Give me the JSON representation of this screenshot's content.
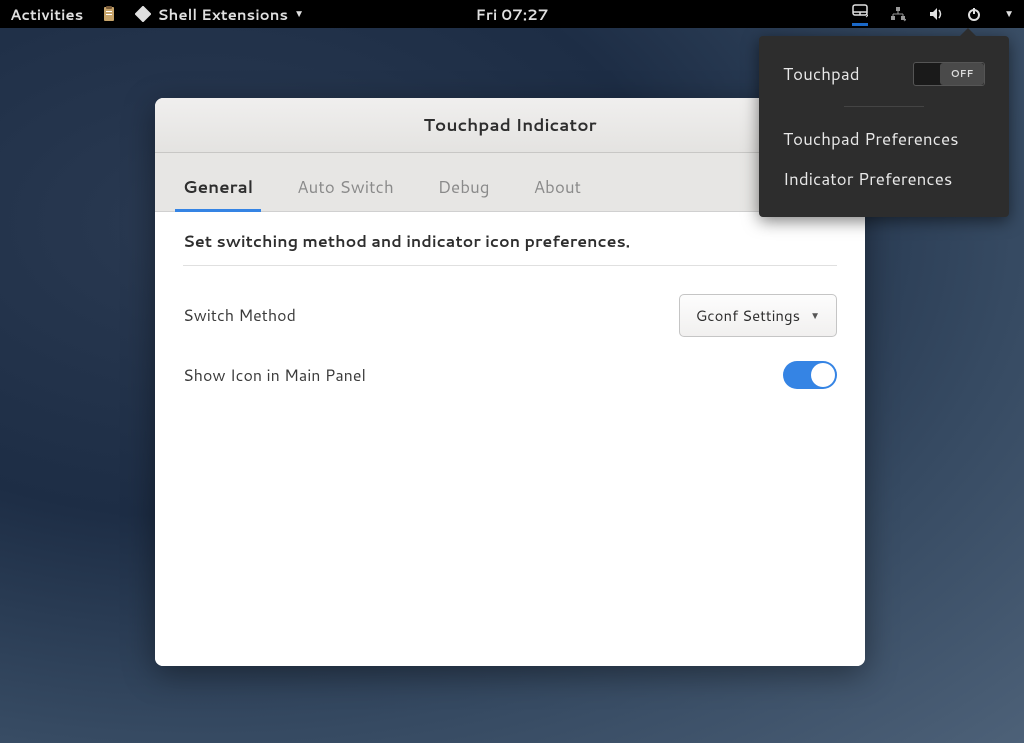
{
  "panel": {
    "activities": "Activities",
    "app_name": "Shell Extensions",
    "clock": "Fri 07:27"
  },
  "popup": {
    "touchpad_label": "Touchpad",
    "toggle_state": "OFF",
    "preferences": "Touchpad Preferences",
    "indicator_preferences": "Indicator Preferences"
  },
  "window": {
    "title": "Touchpad Indicator",
    "tabs": {
      "general": "General",
      "auto_switch": "Auto Switch",
      "debug": "Debug",
      "about": "About"
    },
    "content": {
      "header": "Set switching method and indicator icon preferences.",
      "switch_method_label": "Switch Method",
      "switch_method_value": "Gconf Settings",
      "show_icon_label": "Show Icon in Main Panel"
    }
  }
}
